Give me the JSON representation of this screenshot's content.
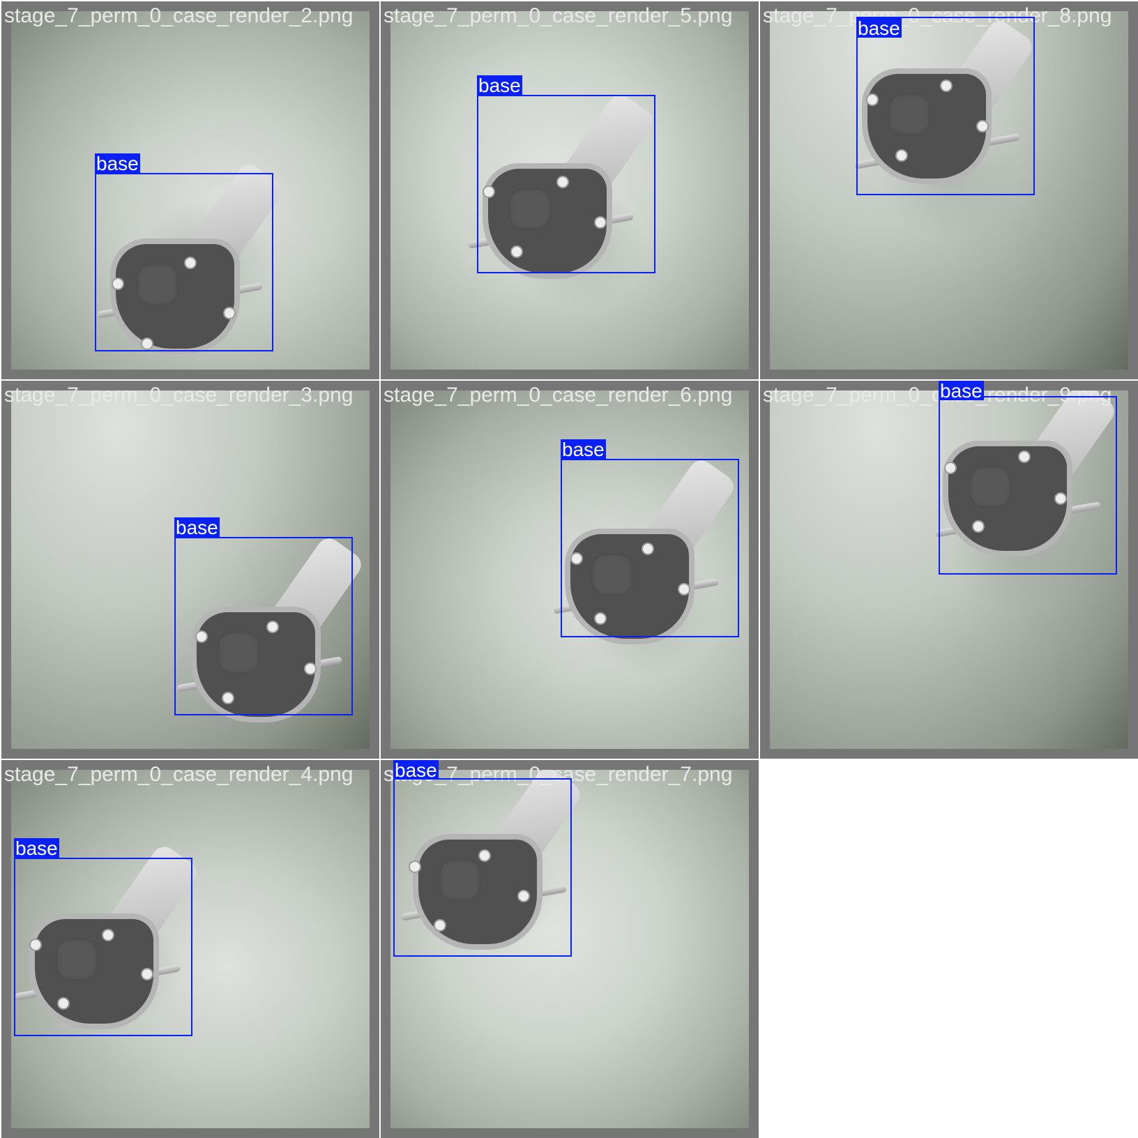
{
  "grid": {
    "tiles": [
      {
        "filename": "stage_7_perm_0_case_render_2.png",
        "detection": {
          "label": "base"
        }
      },
      {
        "filename": "stage_7_perm_0_case_render_5.png",
        "detection": {
          "label": "base"
        }
      },
      {
        "filename": "stage_7_perm_0_case_render_8.png",
        "detection": {
          "label": "base"
        }
      },
      {
        "filename": "stage_7_perm_0_case_render_3.png",
        "detection": {
          "label": "base"
        }
      },
      {
        "filename": "stage_7_perm_0_case_render_6.png",
        "detection": {
          "label": "base"
        }
      },
      {
        "filename": "stage_7_perm_0_case_render_9.png",
        "detection": {
          "label": "base"
        }
      },
      {
        "filename": "stage_7_perm_0_case_render_4.png",
        "detection": {
          "label": "base"
        }
      },
      {
        "filename": "stage_7_perm_0_case_render_7.png",
        "detection": {
          "label": "base"
        }
      }
    ]
  },
  "colors": {
    "box_stroke": "#0a21f5",
    "label_background": "#0a21f5",
    "label_text": "#ffffff",
    "tile_frame": "#767676",
    "title_text": "#e9e9e9"
  },
  "icons": {
    "object": "vacuum-pump-part-icon"
  }
}
